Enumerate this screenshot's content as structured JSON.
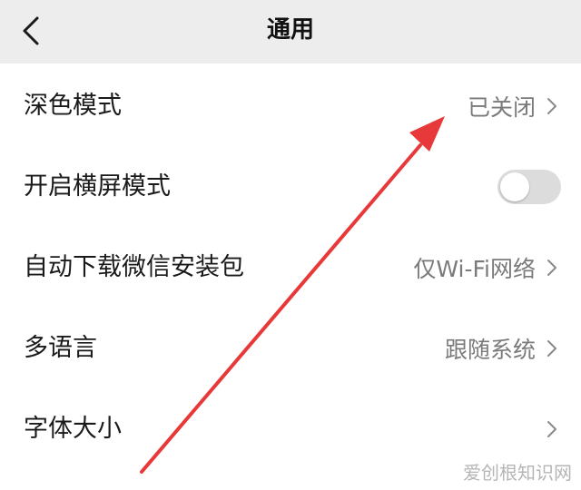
{
  "header": {
    "title": "通用",
    "back_icon": "chevron-left-icon"
  },
  "settings": [
    {
      "label": "深色模式",
      "value": "已关闭",
      "control": "chevron"
    },
    {
      "label": "开启横屏模式",
      "value": "",
      "control": "toggle",
      "toggle_on": false
    },
    {
      "label": "自动下载微信安装包",
      "value": "仅Wi-Fi网络",
      "control": "chevron"
    },
    {
      "label": "多语言",
      "value": "跟随系统",
      "control": "chevron"
    },
    {
      "label": "字体大小",
      "value": "",
      "control": "chevron"
    }
  ],
  "annotation": {
    "arrow_color": "#e8393a"
  },
  "watermark": "爱创根知识网",
  "colors": {
    "header_bg": "#ededed",
    "page_bg": "#ffffff",
    "value_text": "#7a7a7a",
    "toggle_off": "#dcdcdc"
  }
}
